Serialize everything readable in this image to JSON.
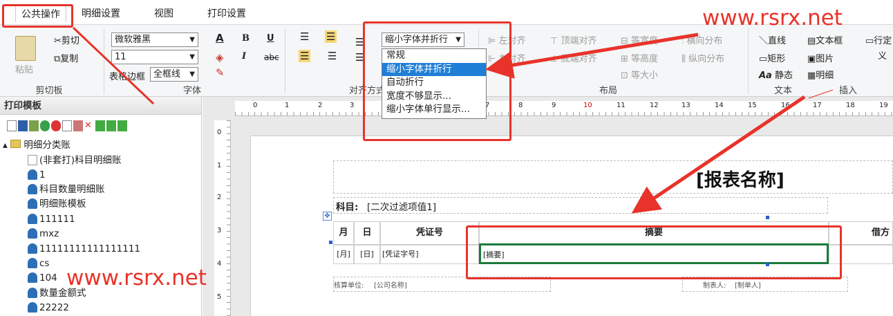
{
  "tabs": [
    {
      "label": "公共操作"
    },
    {
      "label": "明细设置"
    },
    {
      "label": "视图"
    },
    {
      "label": "打印设置"
    }
  ],
  "clipboard": {
    "paste": "粘贴",
    "cut": "剪切",
    "copy": "复制",
    "group": "剪切板"
  },
  "font": {
    "family": "微软雅黑",
    "size": "11",
    "border_label": "表格边框",
    "border_value": "全框线",
    "group": "字体"
  },
  "align": {
    "wrap_value": "缩小字体并折行",
    "group": "对齐方式",
    "options": [
      "常规",
      "缩小字体并折行",
      "自动折行",
      "宽度不够显示...",
      "缩小字体单行显示..."
    ]
  },
  "layout": {
    "left": "左对齐",
    "right": "右对齐",
    "top": "顶端对齐",
    "bottom": "底端对齐",
    "eqwidth": "等宽度",
    "eqheight": "等高度",
    "eqsize": "等大小",
    "hdist": "横向分布",
    "vdist": "纵向分布",
    "group": "布局"
  },
  "text": {
    "line": "直线",
    "rect": "矩形",
    "static": "静态",
    "textbox": "文本框",
    "image": "图片",
    "detail": "明细",
    "group_text": "文本",
    "group_insert": "插入",
    "row_def": "行定",
    "def_tail": "义"
  },
  "panel": {
    "title": "打印模板",
    "root": "明细分类账",
    "items": [
      "(非套打)科目明细账",
      "1",
      "科目数量明细账",
      "明细账模板",
      "111111",
      "mxz",
      "11111111111111111",
      "cs",
      "104",
      "数量金额式",
      "22222"
    ]
  },
  "ruler": {
    "h": [
      "0",
      "1",
      "2",
      "3",
      "7",
      "8",
      "9",
      "10",
      "11",
      "12",
      "13",
      "14",
      "15",
      "16",
      "17",
      "18",
      "19"
    ],
    "v": [
      "0",
      "1",
      "2",
      "3",
      "4",
      "5"
    ]
  },
  "report": {
    "title": "[报表名称]",
    "subject_label": "科目:",
    "subject_value": "[二次过滤项值1]",
    "month": "月",
    "day": "日",
    "voucher": "凭证号",
    "summary": "摘要",
    "debit": "借方",
    "month_val": "[月]",
    "day_val": "[日]",
    "voucher_val": "[凭证字号]",
    "summary_val": "[摘要]",
    "unit_label": "核算单位:",
    "unit_value": "[公司名称]",
    "maker_label": "制表人:",
    "maker_value": "[制单人]"
  },
  "watermark": "www.rsrx.net",
  "colors": {
    "red": "#e8332a",
    "highlight": "#1f7fd6",
    "selection": "#1a7a3a"
  }
}
